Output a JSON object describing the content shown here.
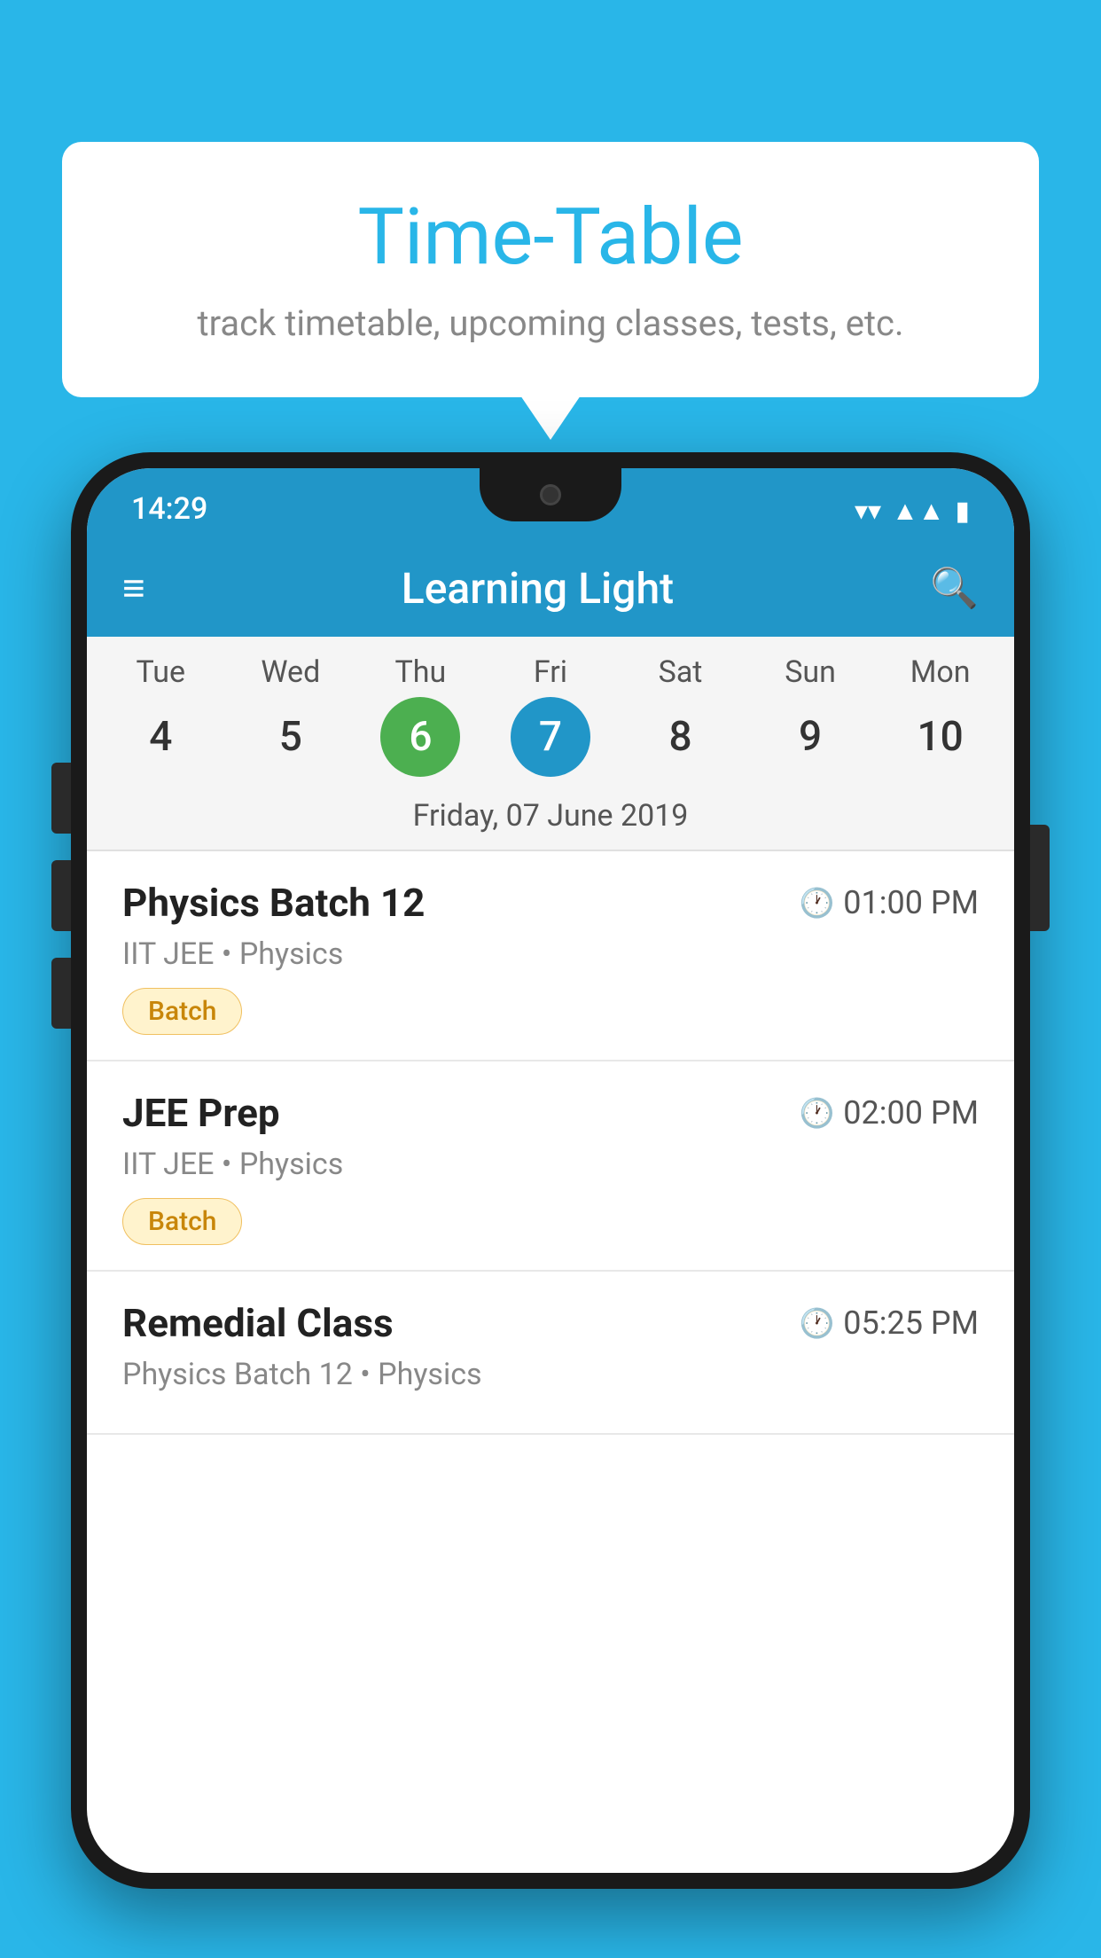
{
  "background_color": "#29B6E8",
  "bubble": {
    "title": "Time-Table",
    "subtitle": "track timetable, upcoming classes, tests, etc."
  },
  "phone": {
    "status_bar": {
      "time": "14:29"
    },
    "app_bar": {
      "title": "Learning Light"
    },
    "calendar": {
      "days": [
        {
          "label": "Tue",
          "num": "4",
          "state": "normal"
        },
        {
          "label": "Wed",
          "num": "5",
          "state": "normal"
        },
        {
          "label": "Thu",
          "num": "6",
          "state": "today"
        },
        {
          "label": "Fri",
          "num": "7",
          "state": "selected"
        },
        {
          "label": "Sat",
          "num": "8",
          "state": "normal"
        },
        {
          "label": "Sun",
          "num": "9",
          "state": "normal"
        },
        {
          "label": "Mon",
          "num": "10",
          "state": "normal"
        }
      ],
      "current_date": "Friday, 07 June 2019"
    },
    "schedule": [
      {
        "title": "Physics Batch 12",
        "time": "01:00 PM",
        "subtitle": "IIT JEE • Physics",
        "badge": "Batch"
      },
      {
        "title": "JEE Prep",
        "time": "02:00 PM",
        "subtitle": "IIT JEE • Physics",
        "badge": "Batch"
      },
      {
        "title": "Remedial Class",
        "time": "05:25 PM",
        "subtitle": "Physics Batch 12 • Physics",
        "badge": null
      }
    ]
  },
  "icons": {
    "hamburger": "≡",
    "search": "🔍",
    "clock": "🕐"
  }
}
